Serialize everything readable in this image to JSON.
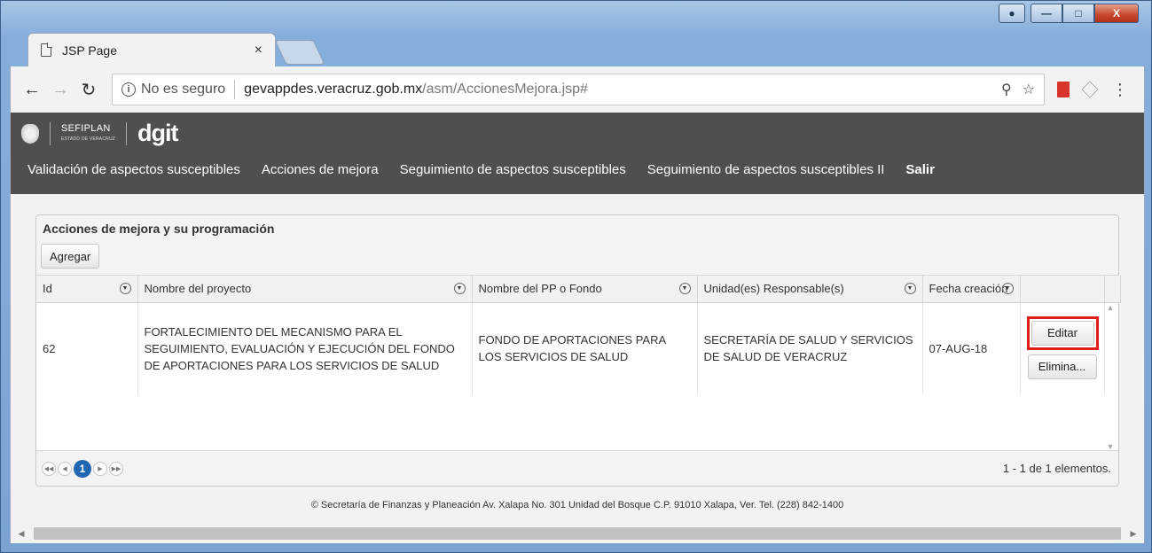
{
  "browser": {
    "tab_title": "JSP Page",
    "tab_close": "×",
    "url_security": "No es seguro",
    "url_host": "gevappdes.veracruz.gob.mx",
    "url_path": "/asm/AccionesMejora.jsp#"
  },
  "header": {
    "org": "SEFIPLAN",
    "org_sub": "ESTADO DE VERACRUZ",
    "brand": "dgit",
    "nav": [
      "Validación de aspectos susceptibles",
      "Acciones de mejora",
      "Seguimiento de aspectos susceptibles",
      "Seguimiento de aspectos susceptibles II",
      "Salir"
    ]
  },
  "panel": {
    "title": "Acciones de mejora y su programación",
    "add_button": "Agregar",
    "columns": [
      "Id",
      "Nombre del proyecto",
      "Nombre del PP o Fondo",
      "Unidad(es) Responsable(s)",
      "Fecha creación"
    ],
    "rows": [
      {
        "id": "62",
        "proyecto": "FORTALECIMIENTO DEL MECANISMO PARA EL SEGUIMIENTO, EVALUACIÓN Y EJECUCIÓN DEL FONDO DE APORTACIONES PARA LOS SERVICIOS DE SALUD",
        "fondo": "FONDO DE APORTACIONES PARA LOS SERVICIOS DE SALUD",
        "unidad": "SECRETARÍA DE SALUD Y SERVICIOS DE SALUD DE VERACRUZ",
        "fecha": "07-AUG-18",
        "edit_label": "Editar",
        "delete_label": "Elimina..."
      }
    ],
    "pager": {
      "current_page": "1",
      "info": "1 - 1 de 1 elementos."
    }
  },
  "footer": {
    "text": "© Secretaría de Finanzas y Planeación Av. Xalapa No. 301 Unidad del Bosque C.P. 91010 Xalapa, Ver. Tel. (228) 842-1400"
  },
  "colors": {
    "header_bg": "#4f4f4f",
    "pager_active": "#2166b1",
    "highlight_border": "#e01b1b"
  }
}
